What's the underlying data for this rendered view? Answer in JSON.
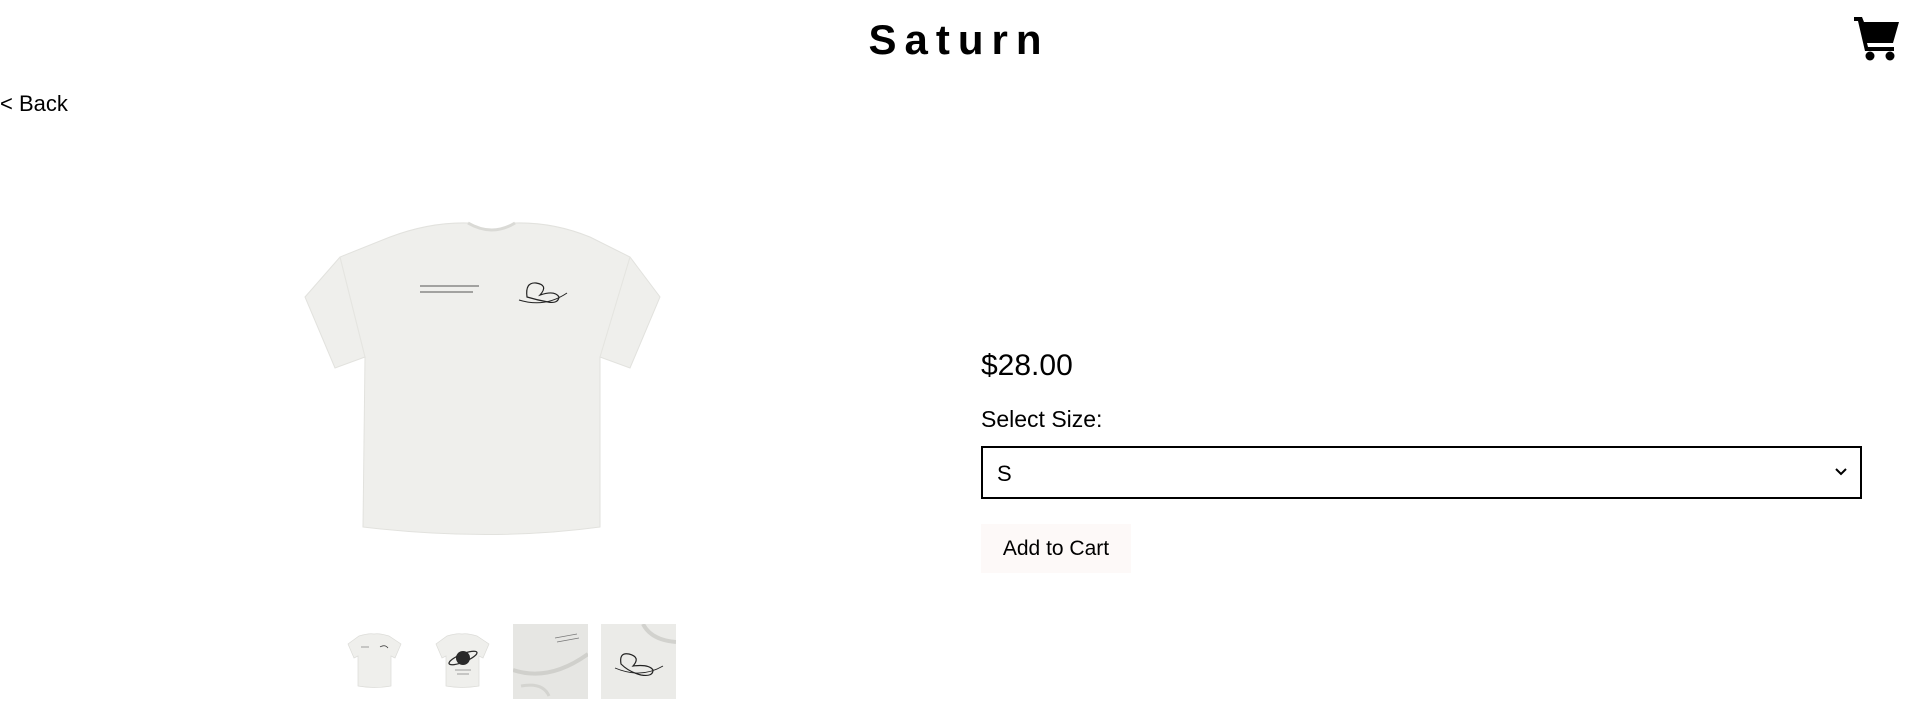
{
  "header": {
    "brand": "Saturn",
    "cart_icon": "shopping-cart-icon"
  },
  "nav": {
    "back_label": "< Back"
  },
  "product": {
    "main_image_alt": "T-shirt front",
    "thumbnails": [
      "front",
      "back",
      "fabric detail",
      "logo detail"
    ],
    "price": "$28.00",
    "size_label": "Select Size:",
    "selected_size": "S",
    "add_to_cart_label": "Add to Cart"
  },
  "colors": {
    "shirt": "#efefec",
    "button_bg": "#fdf9f8",
    "text": "#000000"
  }
}
